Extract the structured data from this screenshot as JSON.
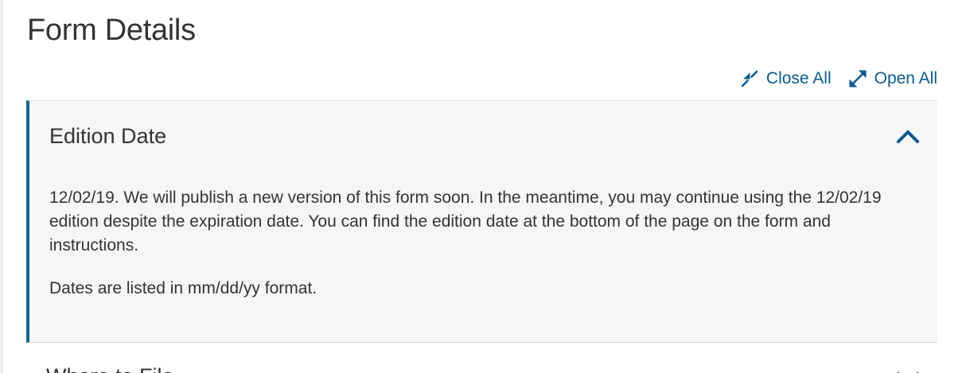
{
  "page": {
    "title": "Form Details"
  },
  "controls": {
    "close_all": "Close All",
    "open_all": "Open All"
  },
  "accordion": {
    "items": [
      {
        "title": "Edition Date",
        "expanded": true,
        "paragraphs": [
          "12/02/19. We will publish a new version of this form soon. In the meantime, you may continue using the 12/02/19 edition despite the expiration date. You can find the edition date at the bottom of the page on the form and instructions.",
          "Dates are listed in mm/dd/yy format."
        ]
      },
      {
        "title": "Where to File",
        "expanded": false
      }
    ]
  },
  "colors": {
    "accent": "#1d6190",
    "link": "#0b5a8e",
    "panel_bg": "#f6f6f6",
    "text": "#333333"
  },
  "icons": {
    "close_all": "collapse-arrows-icon",
    "open_all": "expand-arrows-icon",
    "expanded": "chevron-up-icon",
    "collapsed": "chevron-down-icon"
  }
}
